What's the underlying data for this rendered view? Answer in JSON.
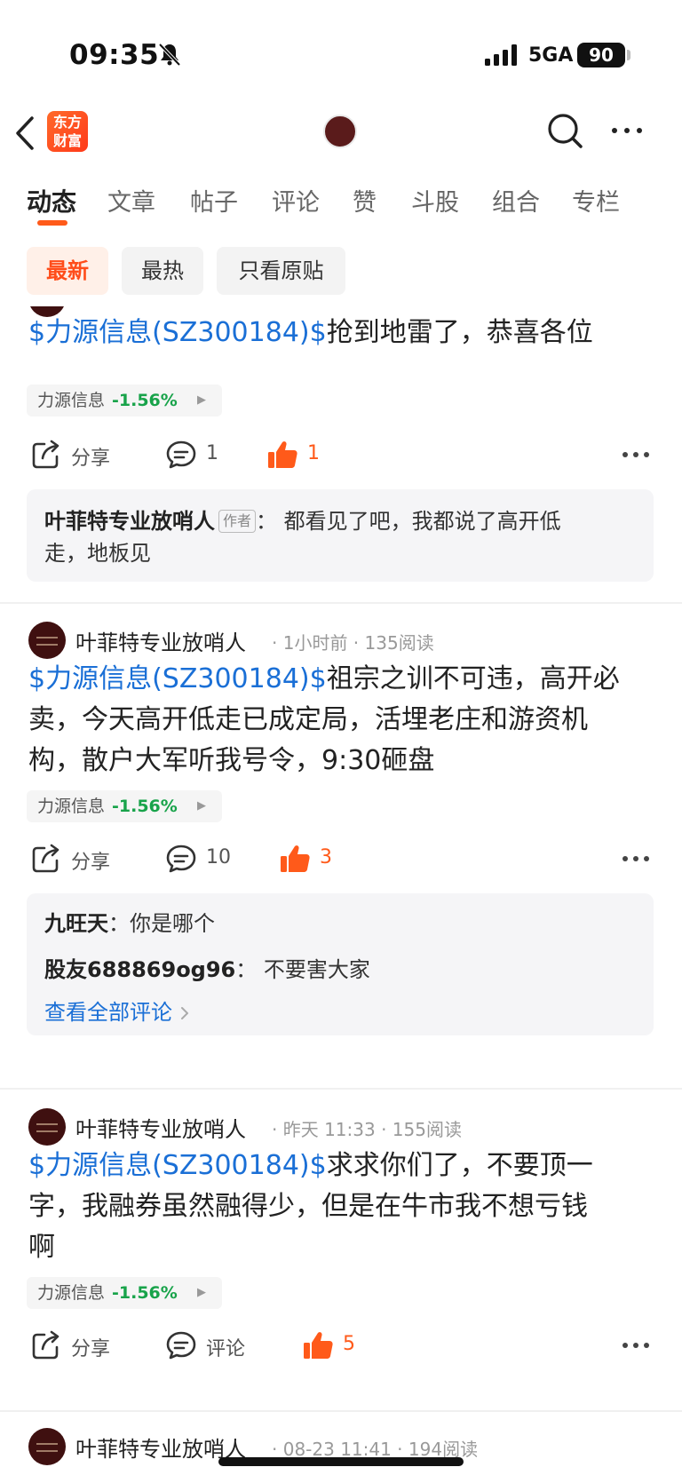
{
  "status_bar": {
    "time": "09:35",
    "network": "5GA",
    "battery": "90"
  },
  "nav": {
    "logo_text": "东方财富",
    "logo_line1": "东方",
    "logo_line2": "财富"
  },
  "tabs": [
    "动态",
    "文章",
    "帖子",
    "评论",
    "赞",
    "斗股",
    "组合",
    "专栏"
  ],
  "filters": [
    "最新",
    "最热",
    "只看原贴"
  ],
  "posts": [
    {
      "tag": "$力源信息(SZ300184)$",
      "text": "抢到地雷了，恭喜各位",
      "stock": {
        "name": "力源信息",
        "change": "-1.56%"
      },
      "share_label": "分享",
      "comments": "1",
      "likes": "1",
      "replies": [
        {
          "name": "叶菲特专业放哨人",
          "badge": "作者",
          "text_line1": "：  都看见了吧，我都说了高开低",
          "text_line2": "走，地板见"
        }
      ]
    },
    {
      "author": "叶菲特专业放哨人",
      "time": "1小时前",
      "reads": "135阅读",
      "tag": "$力源信息(SZ300184)$",
      "text_line1": "祖宗之训不可违，高开必",
      "text_line2": "卖，今天高开低走已成定局，活埋老庄和游资机",
      "text_line3": "构，散户大军听我号令，9:30砸盘",
      "stock": {
        "name": "力源信息",
        "change": "-1.56%"
      },
      "share_label": "分享",
      "comments": "10",
      "likes": "3",
      "replies": [
        {
          "name": "九旺天",
          "text": "：你是哪个"
        },
        {
          "name": "股友688869og96",
          "text": "：  不要害大家"
        }
      ],
      "view_all": "查看全部评论"
    },
    {
      "author": "叶菲特专业放哨人",
      "time": "昨天 11:33",
      "reads": "155阅读",
      "tag": "$力源信息(SZ300184)$",
      "text_line1": "求求你们了，不要顶一",
      "text_line2": "字，我融券虽然融得少，但是在牛市我不想亏钱",
      "text_line3": "啊",
      "stock": {
        "name": "力源信息",
        "change": "-1.56%"
      },
      "share_label": "分享",
      "comments": "评论",
      "likes": "5"
    },
    {
      "author": "叶菲特专业放哨人",
      "time": "08-23 11:41",
      "reads": "194阅读"
    }
  ],
  "colors": {
    "accent": "#ff5a1a",
    "link": "#1a6fd6",
    "down": "#18a34a"
  }
}
